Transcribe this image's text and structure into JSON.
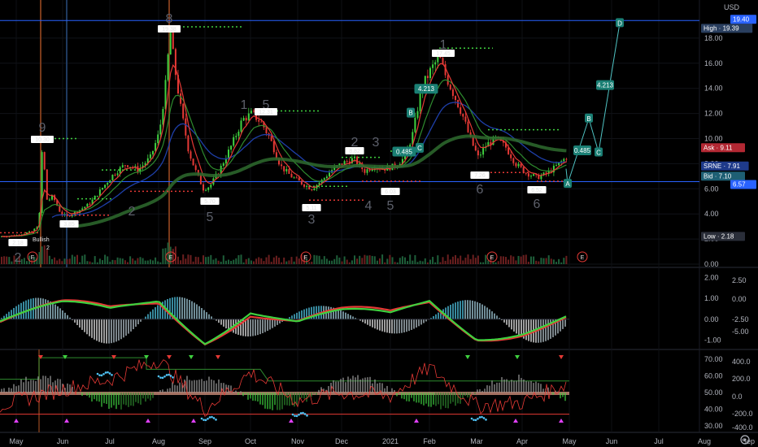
{
  "currency": "USD",
  "price_axis": {
    "labels": [
      "18.00",
      "16.00",
      "14.00",
      "12.00",
      "10.00",
      "8.00",
      "6.00",
      "4.00",
      "2.00",
      "0.00"
    ]
  },
  "macd_axis_left": {
    "labels": [
      "2.00",
      "1.00",
      "0.00",
      "-1.00"
    ]
  },
  "macd_axis_right": {
    "labels": [
      "2.50",
      "0.00",
      "-2.50",
      "-5.00"
    ]
  },
  "osc_axis_left": {
    "labels": [
      "70.00",
      "60.00",
      "50.00",
      "40.00",
      "30.00"
    ]
  },
  "osc_axis_right": {
    "labels": [
      "400.0",
      "200.0",
      "0.0",
      "-200.0",
      "-400.0"
    ]
  },
  "time_axis": {
    "labels": [
      "May",
      "Jun",
      "Jul",
      "Aug",
      "Sep",
      "Oct",
      "Nov",
      "Dec",
      "2021",
      "Feb",
      "Mar",
      "Apr",
      "May",
      "Jun",
      "Jul",
      "Aug",
      "Sep"
    ]
  },
  "price_badges": [
    {
      "name": "high-badge",
      "text": "High · 19.39",
      "color": "#2a3f5f"
    },
    {
      "name": "high-line-badge",
      "text": "19.40",
      "color": "#2962ff"
    },
    {
      "name": "ask-badge",
      "text": "Ask · 9.11",
      "color": "#b22833"
    },
    {
      "name": "srne-badge",
      "text": "SRNE · 7.91",
      "color": "#1e3a8a"
    },
    {
      "name": "bid-badge",
      "text": "Bid · 7.10",
      "color": "#1e5f74"
    },
    {
      "name": "level-badge",
      "text": "6.57",
      "color": "#2962ff"
    },
    {
      "name": "low-badge",
      "text": "Low · 2.18",
      "color": "#2a2e39"
    }
  ],
  "peak_labels": [
    "2.18",
    "10.30",
    "3.85",
    "19.38",
    "5.70",
    "12.31",
    "5.11",
    "8.82",
    "6.03",
    "17.45",
    "7.26",
    "6.52"
  ],
  "wave_labels": [
    "9",
    "8",
    "1",
    "5",
    "2",
    "3",
    "4",
    "5",
    "1",
    "2",
    "3",
    "4",
    "5",
    "5",
    "2",
    "6",
    "6"
  ],
  "projection": {
    "labels": [
      "A",
      "B",
      "C",
      "D"
    ],
    "values": [
      "0.485",
      "4.213"
    ],
    "history_labels": [
      "B",
      "C",
      "4.213",
      "0.485"
    ]
  },
  "annotation": {
    "text": "Bullish",
    "sub": "2"
  },
  "earnings_marker": "E",
  "chart_data": [
    {
      "type": "line",
      "title": "",
      "ylim": [
        0,
        20
      ],
      "x": [
        "May",
        "Jun",
        "Jul",
        "Aug",
        "Sep",
        "Oct",
        "Nov",
        "Dec",
        "2021",
        "Feb",
        "Mar",
        "Apr",
        "May"
      ],
      "series": [
        {
          "values": [
            2.2,
            3.0,
            5.2,
            7.5,
            6.0,
            11.0,
            6.2,
            7.5,
            7.0,
            14.5,
            10.5,
            7.6,
            8.0
          ]
        }
      ],
      "reference_lines": {
        "high": 19.4,
        "level": 6.57
      }
    },
    {
      "type": "bar",
      "title": "",
      "ylim": [
        -1.3,
        2.3
      ],
      "x": [
        "May",
        "Jun",
        "Jul",
        "Aug",
        "Sep",
        "Oct",
        "Nov",
        "Dec",
        "2021",
        "Feb",
        "Mar",
        "Apr",
        "May"
      ],
      "series": [
        {
          "values": [
            0.0,
            0.5,
            0.3,
            2.0,
            -1.1,
            1.2,
            -0.6,
            -0.2,
            -0.1,
            1.8,
            -0.8,
            -0.5,
            0.2
          ]
        }
      ]
    },
    {
      "type": "line",
      "title": "",
      "ylim": [
        28,
        73
      ],
      "x": [
        "May",
        "Jun",
        "Jul",
        "Aug",
        "Sep",
        "Oct",
        "Nov",
        "Dec",
        "2021",
        "Feb",
        "Mar",
        "Apr",
        "May"
      ],
      "series": [
        {
          "values": [
            45,
            52,
            58,
            70,
            40,
            62,
            45,
            50,
            48,
            65,
            42,
            44,
            56
          ]
        }
      ]
    }
  ]
}
